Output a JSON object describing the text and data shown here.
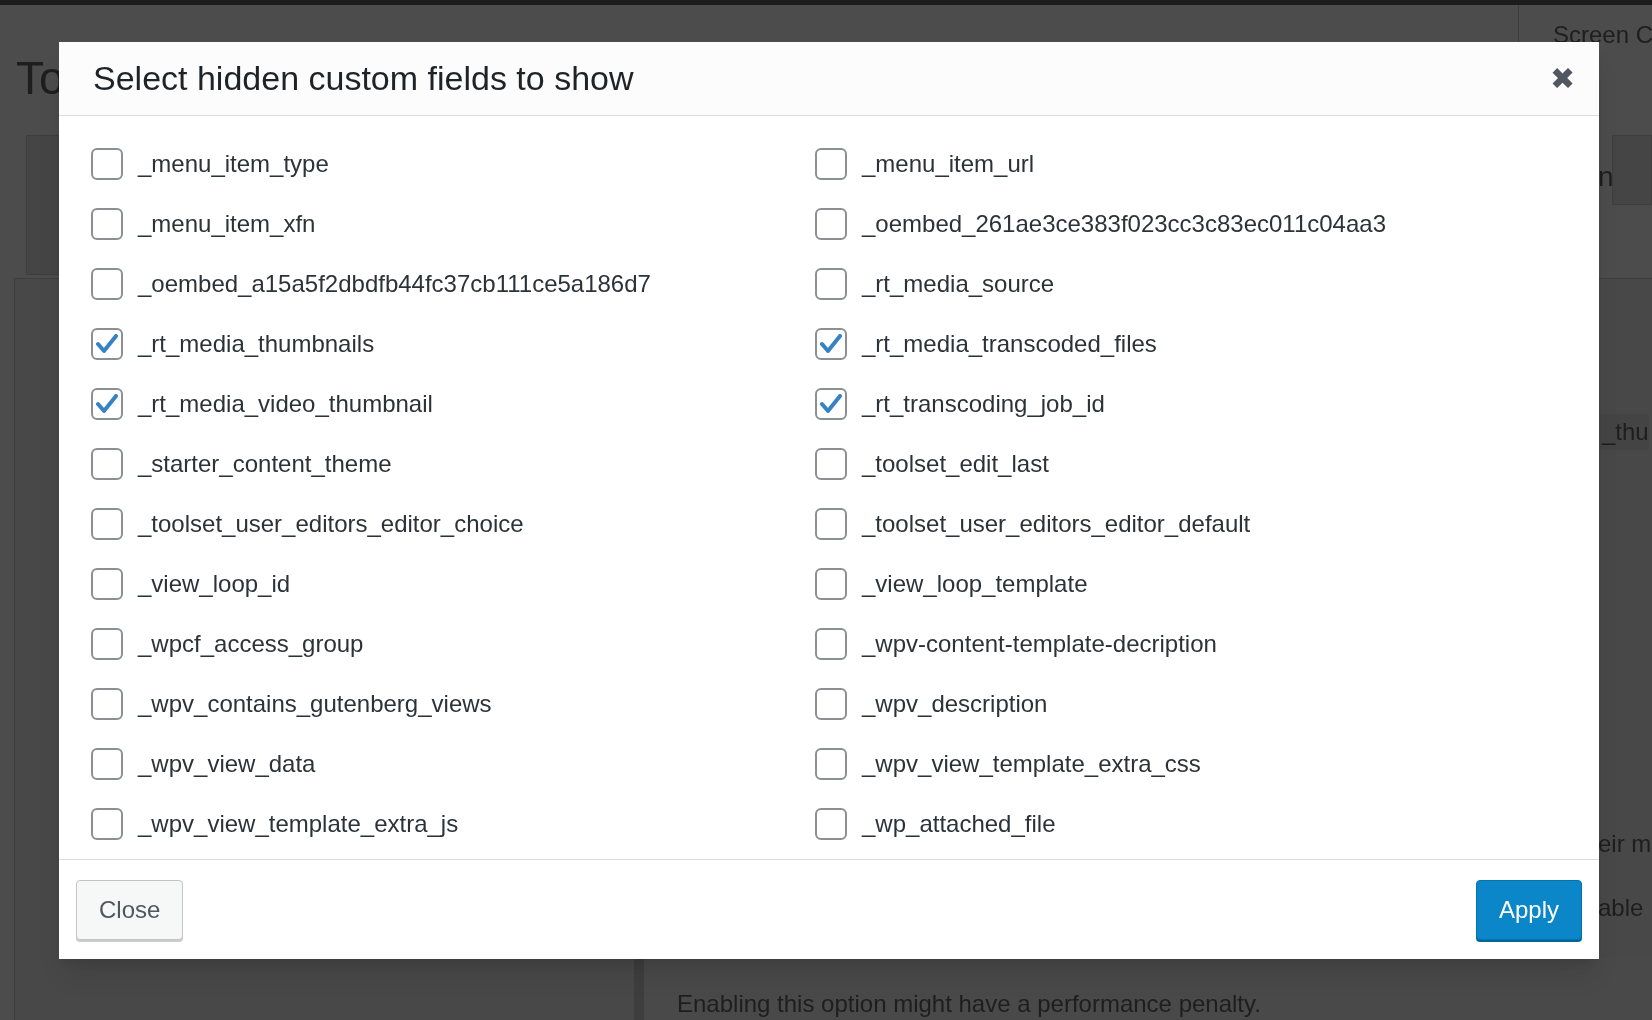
{
  "page": {
    "title_fragment": "To",
    "screen_options_fragment": "Screen C",
    "fragments": [
      "n",
      "_thu",
      "eir m",
      "able"
    ],
    "notice": "Enabling this option might have a performance penalty."
  },
  "dialog": {
    "title": "Select hidden custom fields to show",
    "close_icon": "✖",
    "fields": [
      {
        "label": "_menu_item_type",
        "checked": false
      },
      {
        "label": "_menu_item_url",
        "checked": false
      },
      {
        "label": "_menu_item_xfn",
        "checked": false
      },
      {
        "label": "_oembed_261ae3ce383f023cc3c83ec011c04aa3",
        "checked": false
      },
      {
        "label": "_oembed_a15a5f2dbdfb44fc37cb111ce5a186d7",
        "checked": false
      },
      {
        "label": "_rt_media_source",
        "checked": false
      },
      {
        "label": "_rt_media_thumbnails",
        "checked": true
      },
      {
        "label": "_rt_media_transcoded_files",
        "checked": true
      },
      {
        "label": "_rt_media_video_thumbnail",
        "checked": true
      },
      {
        "label": "_rt_transcoding_job_id",
        "checked": true
      },
      {
        "label": "_starter_content_theme",
        "checked": false
      },
      {
        "label": "_toolset_edit_last",
        "checked": false
      },
      {
        "label": "_toolset_user_editors_editor_choice",
        "checked": false
      },
      {
        "label": "_toolset_user_editors_editor_default",
        "checked": false
      },
      {
        "label": "_view_loop_id",
        "checked": false
      },
      {
        "label": "_view_loop_template",
        "checked": false
      },
      {
        "label": "_wpcf_access_group",
        "checked": false
      },
      {
        "label": "_wpv-content-template-decription",
        "checked": false
      },
      {
        "label": "_wpv_contains_gutenberg_views",
        "checked": false
      },
      {
        "label": "_wpv_description",
        "checked": false
      },
      {
        "label": "_wpv_view_data",
        "checked": false
      },
      {
        "label": "_wpv_view_template_extra_css",
        "checked": false
      },
      {
        "label": "_wpv_view_template_extra_js",
        "checked": false
      },
      {
        "label": "_wp_attached_file",
        "checked": false
      }
    ],
    "buttons": [
      {
        "label": "Close",
        "kind": "secondary"
      },
      {
        "label": "Apply",
        "kind": "primary"
      }
    ]
  }
}
